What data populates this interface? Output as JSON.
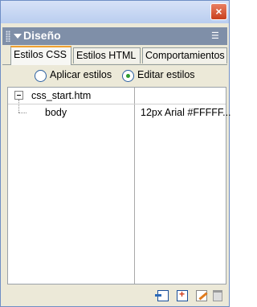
{
  "panel": {
    "title": "Diseño",
    "close_glyph": "×",
    "options_glyph": "☰"
  },
  "tabs": [
    {
      "label": "Estilos CSS",
      "active": true
    },
    {
      "label": "Estilos HTML",
      "active": false
    },
    {
      "label": "Comportamientos",
      "active": false
    }
  ],
  "mode": {
    "apply_label": "Aplicar estilos",
    "edit_label": "Editar estilos",
    "selected": "edit"
  },
  "stylesheet": {
    "file": "css_start.htm",
    "rules": [
      {
        "selector": "body",
        "value": "12px Arial #FFFFF..."
      }
    ]
  },
  "footer_icons": [
    "attach-stylesheet-icon",
    "new-css-rule-icon",
    "edit-style-icon",
    "trash-icon"
  ]
}
